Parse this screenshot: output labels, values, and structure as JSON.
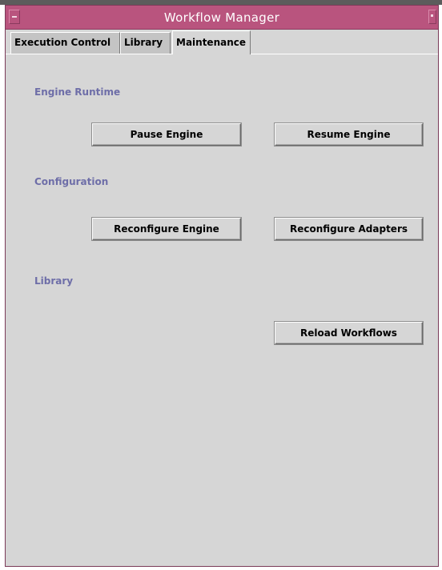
{
  "window": {
    "title": "Workflow Manager"
  },
  "tabs": [
    {
      "label": "Execution Control",
      "active": false
    },
    {
      "label": "Library",
      "active": false
    },
    {
      "label": "Maintenance",
      "active": true
    }
  ],
  "sections": {
    "engine_runtime": {
      "label": "Engine Runtime",
      "pause_button": "Pause Engine",
      "resume_button": "Resume Engine"
    },
    "configuration": {
      "label": "Configuration",
      "reconfigure_engine_button": "Reconfigure Engine",
      "reconfigure_adapters_button": "Reconfigure Adapters"
    },
    "library": {
      "label": "Library",
      "reload_workflows_button": "Reload Workflows"
    }
  },
  "colors": {
    "titlebar": "#b9547e",
    "section_label": "#6e6ea8",
    "panel": "#d6d6d6"
  },
  "icons": {
    "window_menu": "window-menu-icon",
    "maximize": "maximize-icon"
  }
}
